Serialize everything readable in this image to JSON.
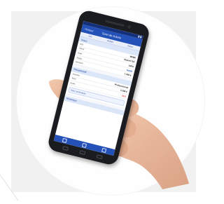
{
  "app": {
    "back_label": "Retour",
    "title": "Suivi de tickets"
  },
  "tabs": [
    "Info",
    "Détails",
    "Statut"
  ],
  "sections": {
    "top": "Ticket",
    "middle": "Récapitulatif",
    "bottom": "Historique"
  },
  "rows_top": [
    {
      "k": "Réf",
      "v": "88386"
    },
    {
      "k": "Client",
      "v": "Dupont SA"
    },
    {
      "k": "Date",
      "v": "12/04"
    },
    {
      "k": "Statut",
      "v": "Validé"
    },
    {
      "k": "Montant",
      "v": "1 250 €"
    }
  ],
  "rows_mid": [
    {
      "k": "Nombre",
      "v": "Professionnel"
    },
    {
      "k": "Total",
      "v": "3 285 €"
    },
    {
      "k": "Écart",
      "v": "-12 €"
    }
  ],
  "pill_label": "Suivi commande",
  "colors": {
    "primary": "#2351b8",
    "status_bar": "#14307a",
    "phone_body": "#1b1c1f"
  },
  "icons": [
    "home-icon",
    "list-icon",
    "user-icon"
  ]
}
